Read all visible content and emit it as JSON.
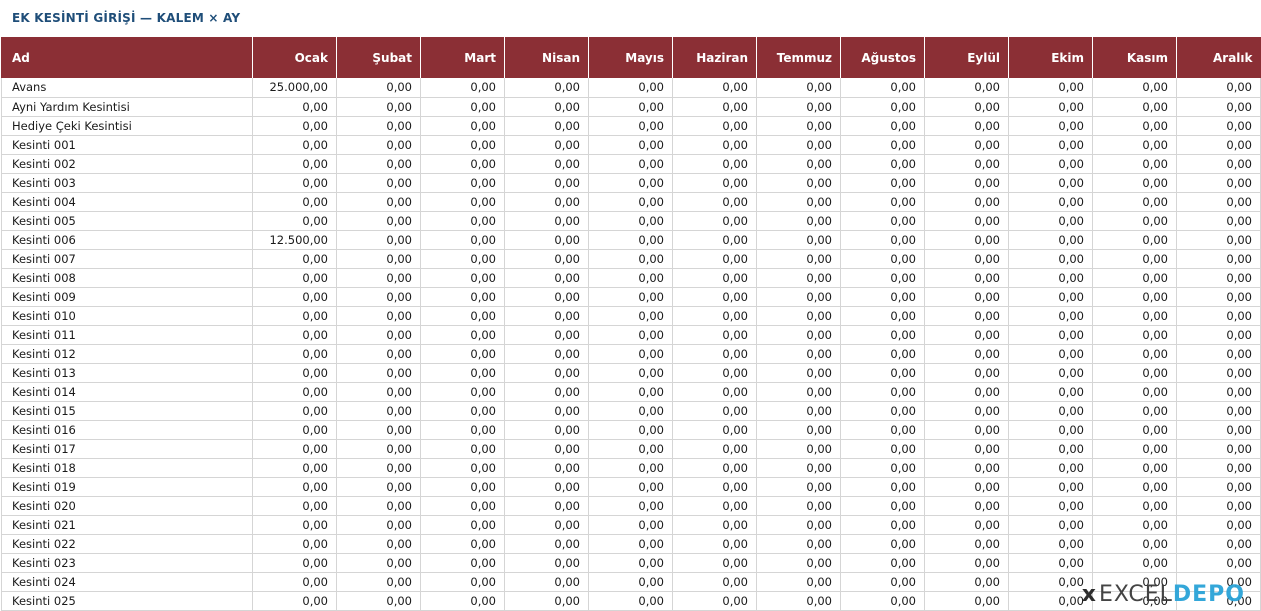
{
  "title": "EK KESİNTİ GİRİŞİ — KALEM × AY",
  "columns": [
    "Ad",
    "Ocak",
    "Şubat",
    "Mart",
    "Nisan",
    "Mayıs",
    "Haziran",
    "Temmuz",
    "Ağustos",
    "Eylül",
    "Ekim",
    "Kasım",
    "Aralık"
  ],
  "rows": [
    {
      "name": "Avans",
      "values": [
        "25.000,00",
        "0,00",
        "0,00",
        "0,00",
        "0,00",
        "0,00",
        "0,00",
        "0,00",
        "0,00",
        "0,00",
        "0,00",
        "0,00"
      ]
    },
    {
      "name": "Ayni Yardım Kesintisi",
      "values": [
        "0,00",
        "0,00",
        "0,00",
        "0,00",
        "0,00",
        "0,00",
        "0,00",
        "0,00",
        "0,00",
        "0,00",
        "0,00",
        "0,00"
      ]
    },
    {
      "name": "Hediye Çeki Kesintisi",
      "values": [
        "0,00",
        "0,00",
        "0,00",
        "0,00",
        "0,00",
        "0,00",
        "0,00",
        "0,00",
        "0,00",
        "0,00",
        "0,00",
        "0,00"
      ]
    },
    {
      "name": "Kesinti 001",
      "values": [
        "0,00",
        "0,00",
        "0,00",
        "0,00",
        "0,00",
        "0,00",
        "0,00",
        "0,00",
        "0,00",
        "0,00",
        "0,00",
        "0,00"
      ]
    },
    {
      "name": "Kesinti 002",
      "values": [
        "0,00",
        "0,00",
        "0,00",
        "0,00",
        "0,00",
        "0,00",
        "0,00",
        "0,00",
        "0,00",
        "0,00",
        "0,00",
        "0,00"
      ]
    },
    {
      "name": "Kesinti 003",
      "values": [
        "0,00",
        "0,00",
        "0,00",
        "0,00",
        "0,00",
        "0,00",
        "0,00",
        "0,00",
        "0,00",
        "0,00",
        "0,00",
        "0,00"
      ]
    },
    {
      "name": "Kesinti 004",
      "values": [
        "0,00",
        "0,00",
        "0,00",
        "0,00",
        "0,00",
        "0,00",
        "0,00",
        "0,00",
        "0,00",
        "0,00",
        "0,00",
        "0,00"
      ]
    },
    {
      "name": "Kesinti 005",
      "values": [
        "0,00",
        "0,00",
        "0,00",
        "0,00",
        "0,00",
        "0,00",
        "0,00",
        "0,00",
        "0,00",
        "0,00",
        "0,00",
        "0,00"
      ]
    },
    {
      "name": "Kesinti 006",
      "values": [
        "12.500,00",
        "0,00",
        "0,00",
        "0,00",
        "0,00",
        "0,00",
        "0,00",
        "0,00",
        "0,00",
        "0,00",
        "0,00",
        "0,00"
      ]
    },
    {
      "name": "Kesinti 007",
      "values": [
        "0,00",
        "0,00",
        "0,00",
        "0,00",
        "0,00",
        "0,00",
        "0,00",
        "0,00",
        "0,00",
        "0,00",
        "0,00",
        "0,00"
      ]
    },
    {
      "name": "Kesinti 008",
      "values": [
        "0,00",
        "0,00",
        "0,00",
        "0,00",
        "0,00",
        "0,00",
        "0,00",
        "0,00",
        "0,00",
        "0,00",
        "0,00",
        "0,00"
      ]
    },
    {
      "name": "Kesinti 009",
      "values": [
        "0,00",
        "0,00",
        "0,00",
        "0,00",
        "0,00",
        "0,00",
        "0,00",
        "0,00",
        "0,00",
        "0,00",
        "0,00",
        "0,00"
      ]
    },
    {
      "name": "Kesinti 010",
      "values": [
        "0,00",
        "0,00",
        "0,00",
        "0,00",
        "0,00",
        "0,00",
        "0,00",
        "0,00",
        "0,00",
        "0,00",
        "0,00",
        "0,00"
      ]
    },
    {
      "name": "Kesinti 011",
      "values": [
        "0,00",
        "0,00",
        "0,00",
        "0,00",
        "0,00",
        "0,00",
        "0,00",
        "0,00",
        "0,00",
        "0,00",
        "0,00",
        "0,00"
      ]
    },
    {
      "name": "Kesinti 012",
      "values": [
        "0,00",
        "0,00",
        "0,00",
        "0,00",
        "0,00",
        "0,00",
        "0,00",
        "0,00",
        "0,00",
        "0,00",
        "0,00",
        "0,00"
      ]
    },
    {
      "name": "Kesinti 013",
      "values": [
        "0,00",
        "0,00",
        "0,00",
        "0,00",
        "0,00",
        "0,00",
        "0,00",
        "0,00",
        "0,00",
        "0,00",
        "0,00",
        "0,00"
      ]
    },
    {
      "name": "Kesinti 014",
      "values": [
        "0,00",
        "0,00",
        "0,00",
        "0,00",
        "0,00",
        "0,00",
        "0,00",
        "0,00",
        "0,00",
        "0,00",
        "0,00",
        "0,00"
      ]
    },
    {
      "name": "Kesinti 015",
      "values": [
        "0,00",
        "0,00",
        "0,00",
        "0,00",
        "0,00",
        "0,00",
        "0,00",
        "0,00",
        "0,00",
        "0,00",
        "0,00",
        "0,00"
      ]
    },
    {
      "name": "Kesinti 016",
      "values": [
        "0,00",
        "0,00",
        "0,00",
        "0,00",
        "0,00",
        "0,00",
        "0,00",
        "0,00",
        "0,00",
        "0,00",
        "0,00",
        "0,00"
      ]
    },
    {
      "name": "Kesinti 017",
      "values": [
        "0,00",
        "0,00",
        "0,00",
        "0,00",
        "0,00",
        "0,00",
        "0,00",
        "0,00",
        "0,00",
        "0,00",
        "0,00",
        "0,00"
      ]
    },
    {
      "name": "Kesinti 018",
      "values": [
        "0,00",
        "0,00",
        "0,00",
        "0,00",
        "0,00",
        "0,00",
        "0,00",
        "0,00",
        "0,00",
        "0,00",
        "0,00",
        "0,00"
      ]
    },
    {
      "name": "Kesinti 019",
      "values": [
        "0,00",
        "0,00",
        "0,00",
        "0,00",
        "0,00",
        "0,00",
        "0,00",
        "0,00",
        "0,00",
        "0,00",
        "0,00",
        "0,00"
      ]
    },
    {
      "name": "Kesinti 020",
      "values": [
        "0,00",
        "0,00",
        "0,00",
        "0,00",
        "0,00",
        "0,00",
        "0,00",
        "0,00",
        "0,00",
        "0,00",
        "0,00",
        "0,00"
      ]
    },
    {
      "name": "Kesinti 021",
      "values": [
        "0,00",
        "0,00",
        "0,00",
        "0,00",
        "0,00",
        "0,00",
        "0,00",
        "0,00",
        "0,00",
        "0,00",
        "0,00",
        "0,00"
      ]
    },
    {
      "name": "Kesinti 022",
      "values": [
        "0,00",
        "0,00",
        "0,00",
        "0,00",
        "0,00",
        "0,00",
        "0,00",
        "0,00",
        "0,00",
        "0,00",
        "0,00",
        "0,00"
      ]
    },
    {
      "name": "Kesinti 023",
      "values": [
        "0,00",
        "0,00",
        "0,00",
        "0,00",
        "0,00",
        "0,00",
        "0,00",
        "0,00",
        "0,00",
        "0,00",
        "0,00",
        "0,00"
      ]
    },
    {
      "name": "Kesinti 024",
      "values": [
        "0,00",
        "0,00",
        "0,00",
        "0,00",
        "0,00",
        "0,00",
        "0,00",
        "0,00",
        "0,00",
        "0,00",
        "0,00",
        "0,00"
      ]
    },
    {
      "name": "Kesinti 025",
      "values": [
        "0,00",
        "0,00",
        "0,00",
        "0,00",
        "0,00",
        "0,00",
        "0,00",
        "0,00",
        "0,00",
        "0,00",
        "0,00",
        "0,00"
      ]
    }
  ],
  "watermark": {
    "mark": "x",
    "part1": "EXCEL",
    "part2": "DEPO"
  },
  "colors": {
    "header_bg": "#8b2f35",
    "title": "#1f4e79",
    "watermark_accent": "#2aa3d8"
  }
}
